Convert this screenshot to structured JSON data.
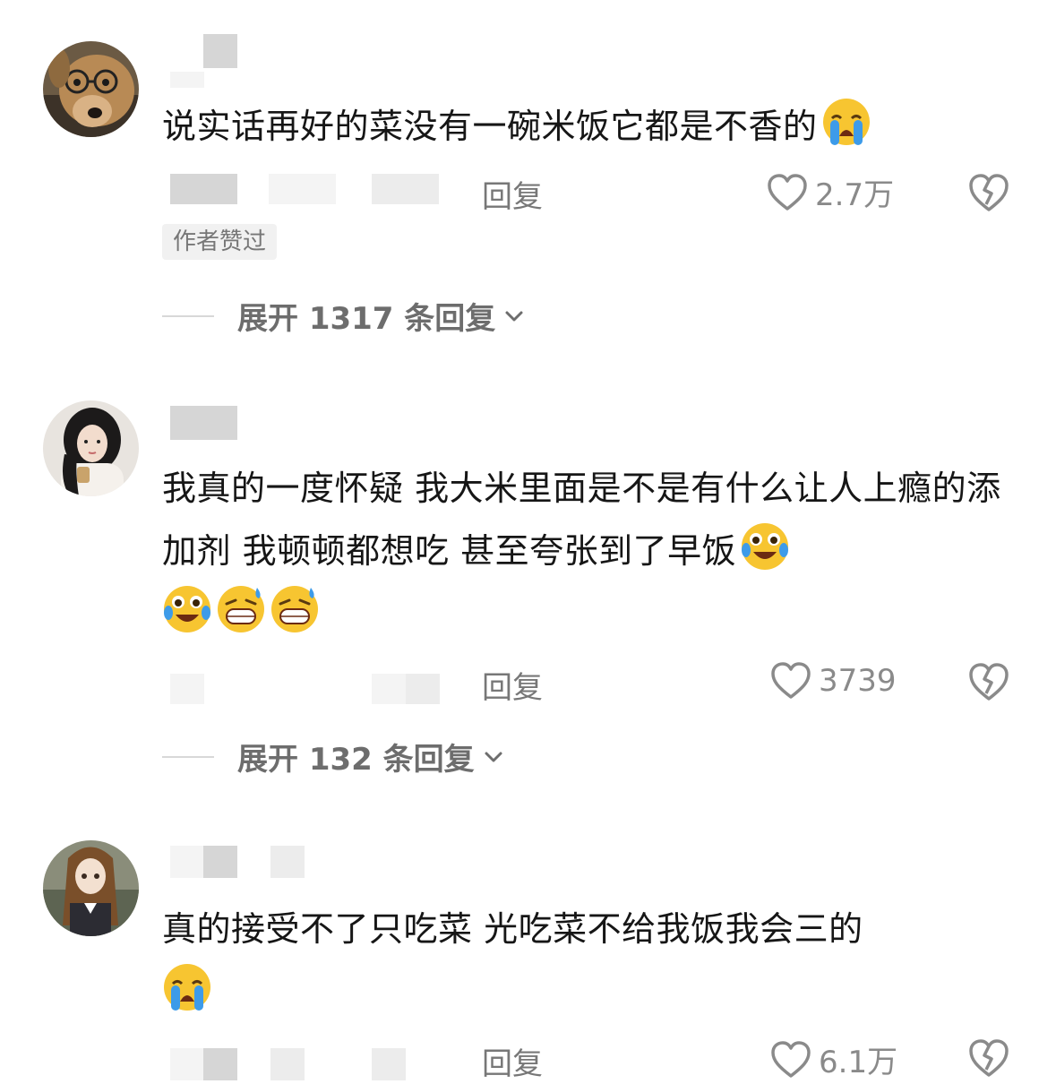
{
  "comments": [
    {
      "text": "说实话再好的菜没有一碗米饭它都是不香的",
      "emojis": [
        "loudly-crying-face"
      ],
      "reply_label": "回复",
      "likes": "2.7万",
      "tag": "作者赞过",
      "expand_label": "展开 1317 条回复"
    },
    {
      "text": "我真的一度怀疑 我大米里面是不是有什么让人上瘾的添加剂 我顿顿都想吃 甚至夸张到了早饭",
      "emojis": [
        "crying-laughing-face",
        "crying-laughing-face",
        "grinning-sweat-face",
        "grinning-sweat-face"
      ],
      "reply_label": "回复",
      "likes": "3739",
      "expand_label": "展开 132 条回复"
    },
    {
      "text": "真的接受不了只吃菜 光吃菜不给我饭我会三的",
      "emojis": [
        "loudly-crying-face"
      ],
      "reply_label": "回复",
      "likes": "6.1万"
    }
  ],
  "colors": {
    "text": "#161616",
    "secondary": "#8a8a8a",
    "emoji_yellow": "#f7c531",
    "tear_blue": "#3d9be9"
  }
}
